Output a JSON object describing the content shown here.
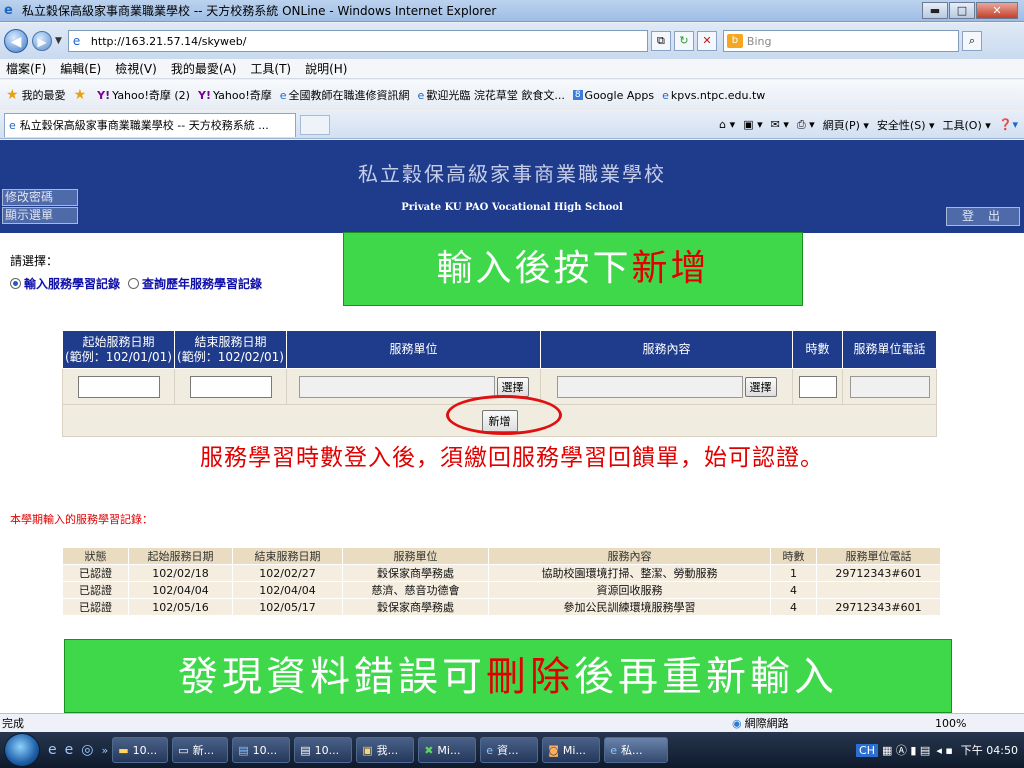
{
  "window": {
    "title": "私立穀保高級家事商業職業學校 -- 天方校務系統 ONLine - Windows Internet Explorer",
    "buttons": {
      "minimize": "▬",
      "maximize": "□",
      "close": "✕"
    }
  },
  "address_bar": {
    "url": "http://163.21.57.14/skyweb/",
    "search_placeholder": "Bing"
  },
  "menu": [
    "檔案(F)",
    "編輯(E)",
    "檢視(V)",
    "我的最愛(A)",
    "工具(T)",
    "說明(H)"
  ],
  "favorites": {
    "label": "我的最愛",
    "items": [
      {
        "icon": "yahoo-icon",
        "label": "Yahoo!奇摩 (2)"
      },
      {
        "icon": "yahoo-icon",
        "label": "Yahoo!奇摩"
      },
      {
        "icon": "ie-page-icon",
        "label": "全國教師在職進修資訊網"
      },
      {
        "icon": "ie-page-icon",
        "label": "歡迎光臨 浣花草堂 飲食文..."
      },
      {
        "icon": "google-icon",
        "label": "Google Apps"
      },
      {
        "icon": "ie-page-icon",
        "label": "kpvs.ntpc.edu.tw"
      }
    ]
  },
  "tab": {
    "title": "私立穀保高級家事商業職業學校 -- 天方校務系統 ...",
    "commands": [
      "網頁(P) ▾",
      "安全性(S) ▾",
      "工具(O) ▾"
    ]
  },
  "header": {
    "school_cn": "私立穀保高級家事商業職業學校",
    "school_en": "Private KU PAO Vocational High School",
    "change_password": "修改密碼",
    "show_menu": "顯示選單",
    "logout": "登出"
  },
  "selection": {
    "label": "請選擇：",
    "options": [
      "輸入服務學習記錄",
      "查詢歷年服務學習記錄"
    ]
  },
  "callout_top": {
    "prefix": "輸入後按下",
    "highlight": "新增"
  },
  "form": {
    "headers": [
      "起始服務日期\n(範例：102/01/01)",
      "結束服務日期\n(範例：102/02/01)",
      "服務單位",
      "服務內容",
      "時數",
      "服務單位電話"
    ],
    "start_date_line1": "起始服務日期",
    "start_date_line2": "(範例：102/01/01)",
    "end_date_line1": "結束服務日期",
    "end_date_line2": "(範例：102/02/01)",
    "unit": "服務單位",
    "content": "服務內容",
    "hours": "時數",
    "phone": "服務單位電話",
    "select_button": "選擇",
    "add_button": "新增"
  },
  "notice": "服務學習時數登入後，須繳回服務學習回饋單，始可認證。",
  "records": {
    "label": "本學期輸入的服務學習記錄：",
    "columns": [
      "狀態",
      "起始服務日期",
      "結束服務日期",
      "服務單位",
      "服務內容",
      "時數",
      "服務單位電話"
    ],
    "rows": [
      [
        "已認證",
        "102/02/18",
        "102/02/27",
        "穀保家商學務處",
        "協助校園環境打掃、整潔、勞動服務",
        "1",
        "29712343#601"
      ],
      [
        "已認證",
        "102/04/04",
        "102/04/04",
        "慈濟、慈音功德會",
        "資源回收服務",
        "4",
        ""
      ],
      [
        "已認證",
        "102/05/16",
        "102/05/17",
        "穀保家商學務處",
        "參加公民訓練環境服務學習",
        "4",
        "29712343#601"
      ]
    ]
  },
  "callout_bottom": {
    "prefix": "發現資料錯誤可",
    "highlight": "刪除",
    "suffix": "後再重新輸入"
  },
  "status_bar": {
    "status": "完成",
    "zone": "網際網路",
    "zoom": "100%"
  },
  "taskbar": {
    "tasks": [
      "10...",
      "新...",
      "10...",
      "10...",
      "我...",
      "Mi...",
      "資...",
      "Mi...",
      "私..."
    ],
    "lang": "CH",
    "clock": "下午 04:50"
  }
}
